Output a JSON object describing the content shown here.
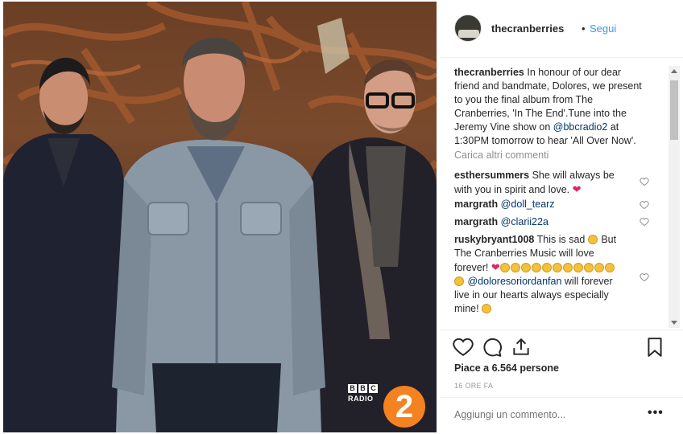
{
  "post": {
    "badge_line1": "BBC",
    "badge_line2": "RADIO",
    "badge_number": "2",
    "badge_color": "#f58220"
  },
  "header": {
    "username": "thecranberries",
    "separator": "•",
    "follow_label": "Segui",
    "follow_color": "#3897f0"
  },
  "caption": {
    "username": "thecranberries",
    "text": "In honour of our dear friend and bandmate, Dolores, we present to you the final album from The Cranberries, 'In The End'.Tune into the Jeremy Vine show on ",
    "mention": "@bbcradio2",
    "text_after": " at 1:30PM tomorrow to hear 'All Over Now'."
  },
  "load_more_label": "Carica altri commenti",
  "comments": [
    {
      "username": "esthersummers",
      "text": "She will always be with you in spirit and love.",
      "icon": "red-heart-icon"
    },
    {
      "username": "margrath",
      "mention": "@doll_tearz"
    },
    {
      "username": "margrath",
      "mention": "@clarii22a"
    },
    {
      "username": "ruskybryant1008",
      "text_a": "This is sad",
      "text_b": "But The Cranberries Music will love forever!",
      "mention": "@doloresoriordanfan",
      "text_c": "will forever live in our hearts always especially mine!"
    }
  ],
  "actions": {
    "like_icon": "heart-outline-icon",
    "comment_icon": "comment-icon",
    "share_icon": "share-icon",
    "save_icon": "bookmark-icon",
    "likes_text": "Piace a 6.564 persone",
    "timestamp": "16 ORE FA"
  },
  "add_comment": {
    "placeholder": "Aggiungi un commento...",
    "more_label": "•••"
  }
}
